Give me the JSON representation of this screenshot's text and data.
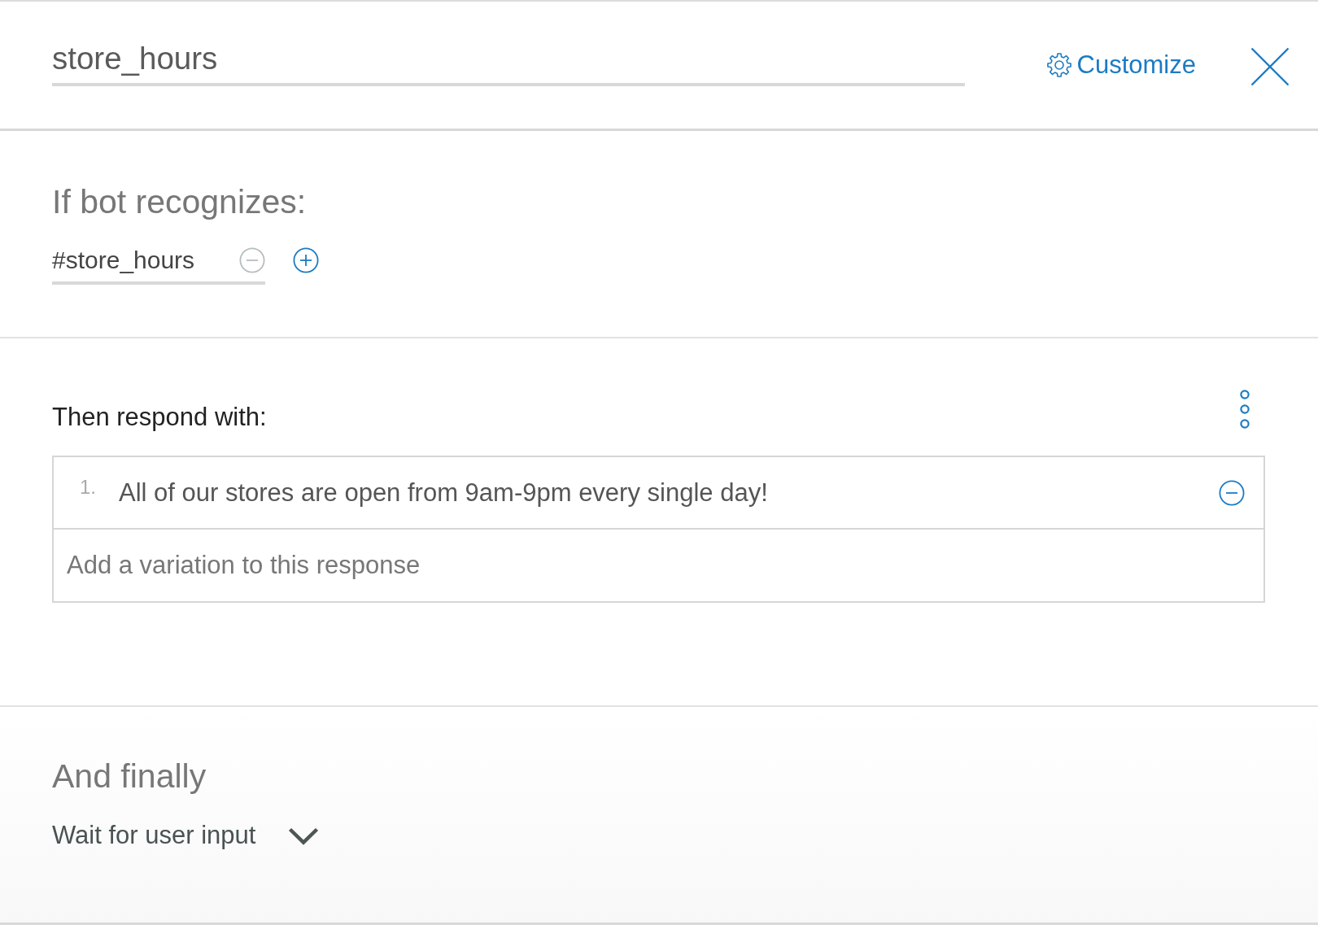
{
  "header": {
    "title": "store_hours",
    "customize_label": "Customize"
  },
  "condition": {
    "heading": "If bot recognizes:",
    "intents": [
      {
        "value": "#store_hours",
        "remove_disabled": true
      }
    ]
  },
  "response": {
    "heading": "Then respond with:",
    "variations": [
      {
        "number": "1.",
        "text": "All of our stores are open from 9am-9pm every single day!",
        "remove_disabled": false
      }
    ],
    "add_placeholder": "Add a variation to this response"
  },
  "finally": {
    "heading": "And finally",
    "action": "Wait for user input"
  }
}
